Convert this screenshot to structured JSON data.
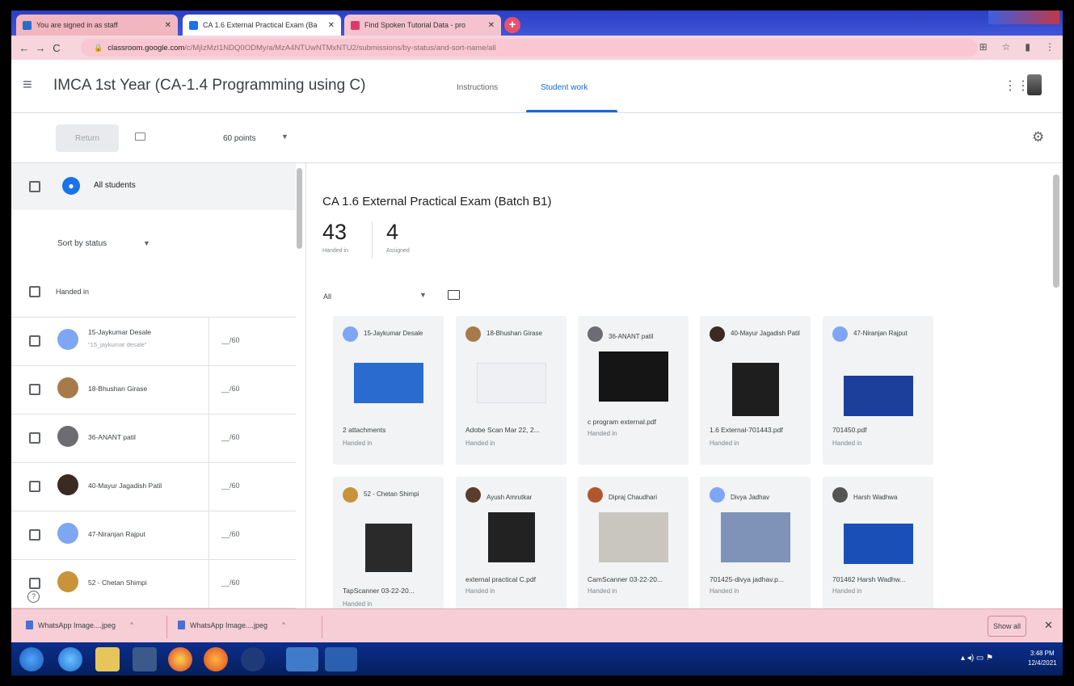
{
  "browser": {
    "tabs": [
      {
        "label": "You are signed in as staff"
      },
      {
        "label": "CA 1.6 External Practical Exam (Ba"
      },
      {
        "label": "Find Spoken Tutorial Data - pro"
      }
    ],
    "url_host": "classroom.google.com",
    "url_path": "/c/MjIzMzI1NDQ0ODMy/a/MzA4NTUwNTMxNTU2/submissions/by-status/and-sort-name/all"
  },
  "app": {
    "class_title": "IMCA 1st Year (CA-1.4 Programming using C)",
    "tab_instructions": "Instructions",
    "tab_student_work": "Student work"
  },
  "toolbar": {
    "return_label": "Return",
    "points": "60 points"
  },
  "left": {
    "all_students": "All students",
    "sort": "Sort by status",
    "section": "Handed in",
    "students": [
      {
        "name": "15-Jaykumar Desale",
        "sub": "\"15_jaykumar desale\"",
        "grade": "__/60",
        "color": "#7ea6f2"
      },
      {
        "name": "18-Bhushan Girase",
        "sub": "",
        "grade": "__/60",
        "color": "#a77a4a"
      },
      {
        "name": "36-ANANT patil",
        "sub": "",
        "grade": "__/60",
        "color": "#6c6c72"
      },
      {
        "name": "40-Mayur Jagadish Patil",
        "sub": "",
        "grade": "__/60",
        "color": "#3a2a22"
      },
      {
        "name": "47-Niranjan Rajput",
        "sub": "",
        "grade": "__/60",
        "color": "#7ea6f2"
      },
      {
        "name": "52 - Chetan Shimpi",
        "sub": "",
        "grade": "__/60",
        "color": "#c8933a"
      }
    ]
  },
  "main": {
    "assignment_title": "CA 1.6 External Practical Exam (Batch B1)",
    "handed_in_count": "43",
    "handed_in_label": "Handed in",
    "assigned_count": "4",
    "assigned_label": "Assigned",
    "filter": "All",
    "cards": [
      {
        "name": "15-Jaykumar Desale",
        "attachment": "2 attachments",
        "status": "Handed in",
        "avatar": "#7ea6f2",
        "thumb": "#2a6bd0"
      },
      {
        "name": "18-Bhushan Girase",
        "attachment": "Adobe Scan Mar 22, 2...",
        "status": "Handed in",
        "avatar": "#a77a4a",
        "thumb": "#eef0f4"
      },
      {
        "name": "36-ANANT patil",
        "attachment": "c program external.pdf",
        "status": "Handed in",
        "avatar": "#6c6c72",
        "thumb": "#151515"
      },
      {
        "name": "40-Mayur Jagadish Patil",
        "attachment": "1.6 External-701443.pdf",
        "status": "Handed in",
        "avatar": "#3a2a22",
        "thumb": "#1e1e1e"
      },
      {
        "name": "47-Niranjan Rajput",
        "attachment": "701450.pdf",
        "status": "Handed in",
        "avatar": "#7ea6f2",
        "thumb": "#1b3f9a"
      },
      {
        "name": "52 - Chetan Shimpi",
        "attachment": "TapScanner 03-22-20...",
        "status": "Handed in",
        "avatar": "#c8933a",
        "thumb": "#2a2a2a"
      },
      {
        "name": "Ayush Amrutkar",
        "attachment": "external practical C.pdf",
        "status": "Handed in",
        "avatar": "#5a3e2b",
        "thumb": "#222222"
      },
      {
        "name": "Dipraj Chaudhari",
        "attachment": "CamScanner 03-22-20...",
        "status": "Handed in",
        "avatar": "#b0562e",
        "thumb": "#c9c6c0"
      },
      {
        "name": "Divya Jadhav",
        "attachment": "701425-divya jadhav.p...",
        "status": "Handed in",
        "avatar": "#7ea6f2",
        "thumb": "#7f93b8"
      },
      {
        "name": "Harsh Wadhwa",
        "attachment": "701462 Harsh Wadhw...",
        "status": "Handed in",
        "avatar": "#555555",
        "thumb": "#1b4fb8"
      }
    ]
  },
  "downloads": {
    "items": [
      "WhatsApp Image....jpeg",
      "WhatsApp Image....jpeg"
    ],
    "show_all": "Show all"
  },
  "taskbar": {
    "time": "3:48 PM",
    "date": "12/4/2021"
  }
}
